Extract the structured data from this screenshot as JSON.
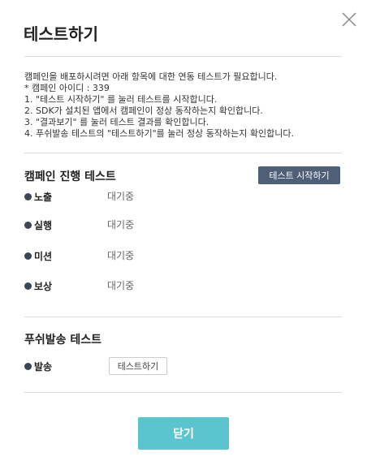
{
  "modal": {
    "title": "테스트하기",
    "close_icon": "close-icon"
  },
  "description": {
    "lines": [
      "캠페인을 배포하시려면 아래 항목에 대한 연동 테스트가 필요합니다.",
      "* 캠페인 아이디 : 339",
      "1. \"테스트 시작하기\" 를 눌러 테스트를 시작합니다.",
      "2. SDK가 설치된 앱에서 캠페인이 정상 동작하는지 확인합니다.",
      "3. \"결과보기\" 를 눌러 테스트 결과를 확인합니다.",
      "4. 푸쉬발송 테스트의 \"테스트하기\"를 눌러 정상 동작하는지 확인합니다."
    ]
  },
  "campaign_test": {
    "title": "캠페인 진행 테스트",
    "start_button": "테스트 시작하기",
    "items": [
      {
        "label": "노출",
        "status": "대기중"
      },
      {
        "label": "실행",
        "status": "대기중"
      },
      {
        "label": "미션",
        "status": "대기중"
      },
      {
        "label": "보상",
        "status": "대기중"
      }
    ]
  },
  "push_test": {
    "title": "푸쉬발송 테스트",
    "item": {
      "label": "발송"
    },
    "button": "테스트하기"
  },
  "footer": {
    "close_button": "닫기"
  },
  "colors": {
    "primary_button": "#4f5f78",
    "close_button": "#5bc5cf",
    "bullet": "#3b4556",
    "divider": "#dddddd"
  }
}
